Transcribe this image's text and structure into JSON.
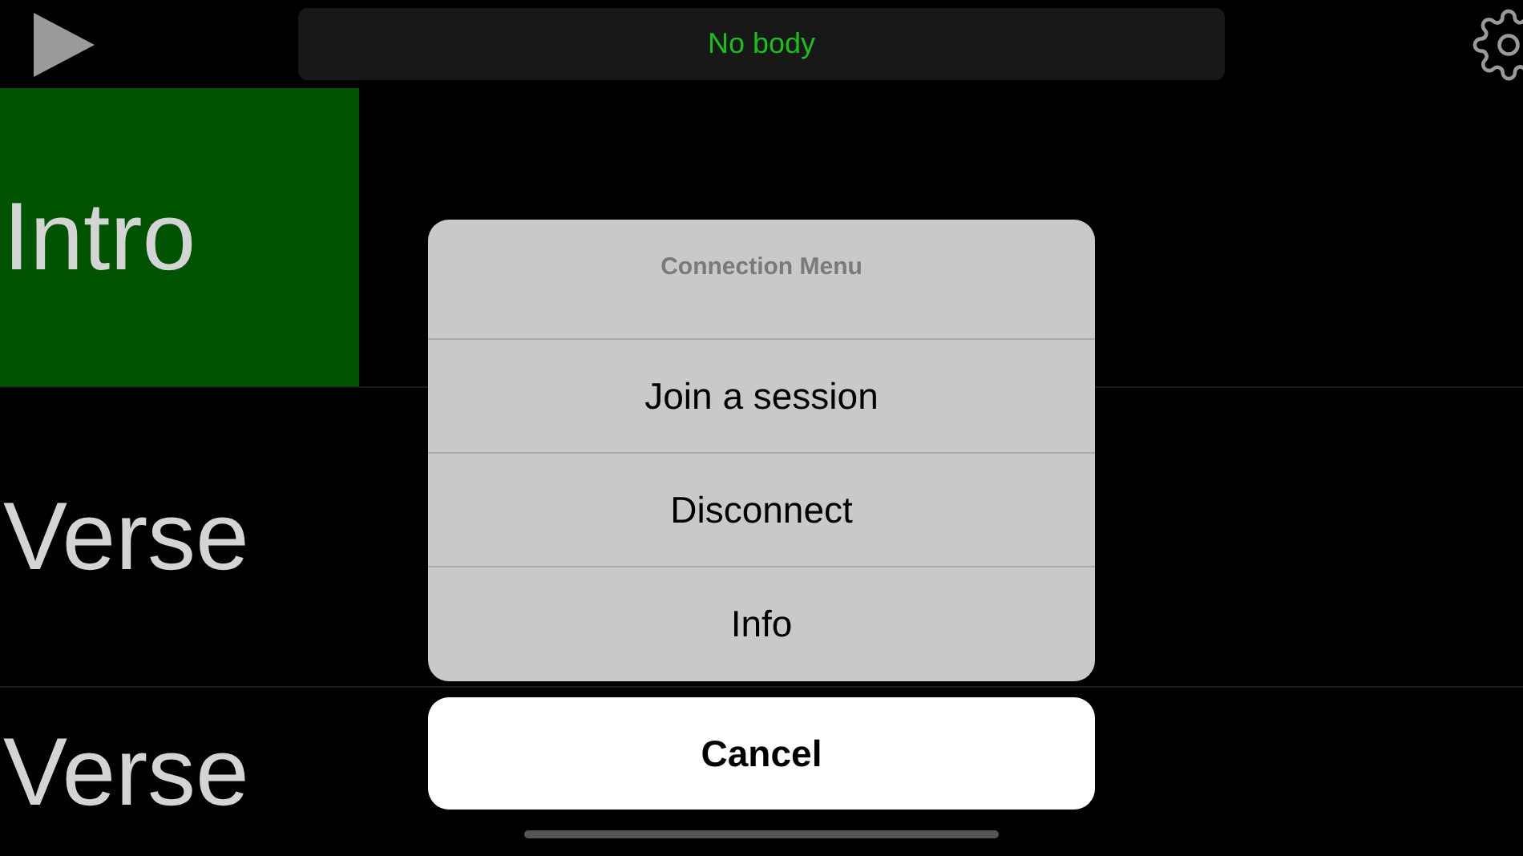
{
  "status": {
    "text": "No body"
  },
  "sections": [
    {
      "label": "Intro",
      "selected": true
    },
    {
      "label": "Verse",
      "selected": false
    },
    {
      "label": "Verse",
      "selected": false
    }
  ],
  "action_sheet": {
    "title": "Connection Menu",
    "actions": [
      "Join a session",
      "Disconnect",
      "Info"
    ],
    "cancel": "Cancel"
  }
}
